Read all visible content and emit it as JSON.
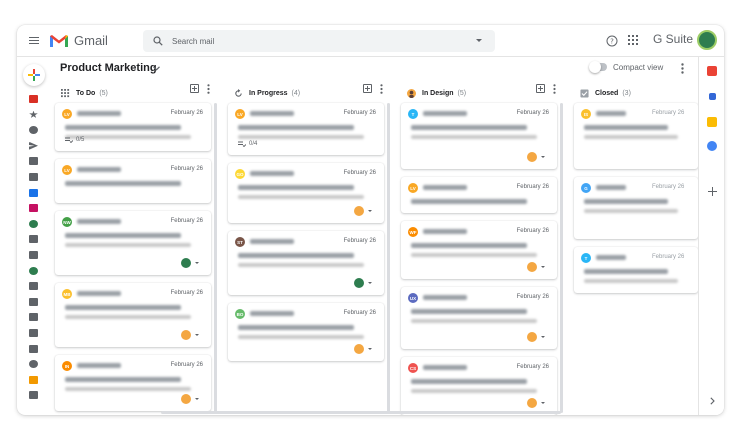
{
  "app": {
    "name": "Gmail",
    "search_placeholder": "Search mail",
    "suite_label": "G Suite"
  },
  "board": {
    "title": "Product Marketing",
    "compact_view_label": "Compact view",
    "compact_view_on": false
  },
  "columns": [
    {
      "title": "To Do",
      "count": "(5)",
      "cards": [
        {
          "date": "February 26",
          "avatar": "LV",
          "avatar_color": "#f9a825",
          "subtask": "0/5",
          "assignee": false
        },
        {
          "date": "February 26",
          "avatar": "LV",
          "avatar_color": "#f9a825",
          "subtask": "",
          "assignee": false
        },
        {
          "date": "February 26",
          "avatar": "NW",
          "avatar_color": "#43a047",
          "subtask": "",
          "assignee": true
        },
        {
          "date": "February 26",
          "avatar": "MB",
          "avatar_color": "#fbc02d",
          "subtask": "",
          "assignee": true
        },
        {
          "date": "February 26",
          "avatar": "IN",
          "avatar_color": "#fb8c00",
          "subtask": "",
          "assignee": true
        }
      ]
    },
    {
      "title": "In Progress",
      "count": "(4)",
      "cards": [
        {
          "date": "February 26",
          "avatar": "LV",
          "avatar_color": "#f9a825",
          "subtask": "0/4",
          "assignee": false
        },
        {
          "date": "February 26",
          "avatar": "GO",
          "avatar_color": "#fdd835",
          "subtask": "",
          "assignee": true
        },
        {
          "date": "February 26",
          "avatar": "ST",
          "avatar_color": "#795548",
          "subtask": "",
          "assignee": true
        },
        {
          "date": "February 26",
          "avatar": "BO",
          "avatar_color": "#66bb6a",
          "subtask": "",
          "assignee": true
        }
      ]
    },
    {
      "title": "In Design",
      "count": "(5)",
      "cards": [
        {
          "date": "February 26",
          "avatar": "T",
          "avatar_color": "#29b6f6",
          "subtask": "",
          "assignee": true
        },
        {
          "date": "February 26",
          "avatar": "LV",
          "avatar_color": "#f9a825",
          "subtask": "",
          "assignee": false
        },
        {
          "date": "February 26",
          "avatar": "WF",
          "avatar_color": "#fb8c00",
          "subtask": "",
          "assignee": true
        },
        {
          "date": "February 26",
          "avatar": "UX",
          "avatar_color": "#5c6bc0",
          "subtask": "",
          "assignee": true
        },
        {
          "date": "February 26",
          "avatar": "CS",
          "avatar_color": "#ef5350",
          "subtask": "",
          "assignee": true
        }
      ]
    },
    {
      "title": "Closed",
      "count": "(3)",
      "cards": [
        {
          "date": "February 26",
          "avatar": "IS",
          "avatar_color": "#fbc02d",
          "subtask": "",
          "assignee": false
        },
        {
          "date": "February 26",
          "avatar": "G",
          "avatar_color": "#42a5f5",
          "subtask": "",
          "assignee": false
        },
        {
          "date": "February 26",
          "avatar": "T",
          "avatar_color": "#29b6f6",
          "subtask": "",
          "assignee": false
        }
      ]
    }
  ]
}
